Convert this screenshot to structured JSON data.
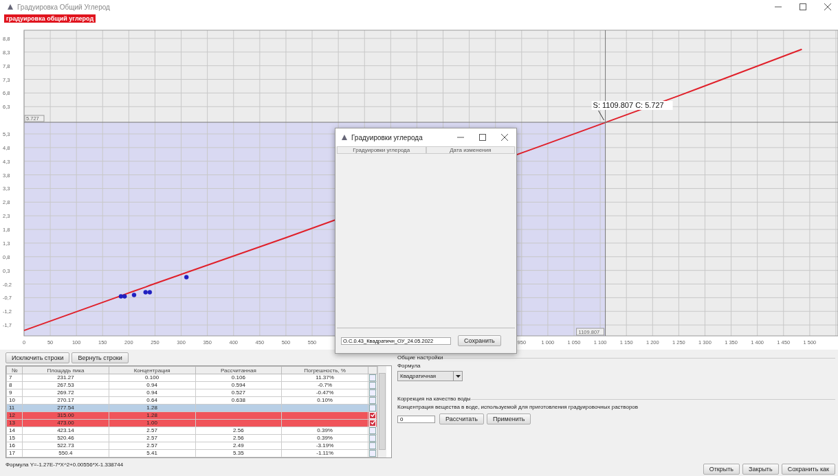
{
  "window": {
    "title": "Градуировка Общий Углерод"
  },
  "badge": "градуировка общий углерод",
  "chart": {
    "chart_data": {
      "type": "scatter",
      "grid": true,
      "x": [
        0,
        185,
        192,
        210,
        232,
        240,
        310,
        500,
        1000,
        1250,
        1485
      ],
      "series": [
        {
          "type": "line",
          "color": "#e0202a",
          "values": [
            -1.9,
            -0.63,
            -0.58,
            -0.46,
            -0.31,
            -0.25,
            0.22,
            1.5,
            4.95,
            6.7,
            8.4
          ]
        },
        {
          "color": "#2020c0",
          "values": [
            null,
            -0.65,
            -0.65,
            -0.6,
            -0.5,
            -0.5,
            0.05,
            null,
            null,
            null,
            null
          ]
        }
      ],
      "xlim": [
        0,
        1554
      ],
      "ylim": [
        -2.1,
        9.1
      ],
      "xticks": [
        0,
        50,
        100,
        150,
        200,
        250,
        300,
        350,
        400,
        450,
        500,
        550,
        950,
        {
          "value": 1000,
          "label": "1 000"
        },
        {
          "value": 1050,
          "label": "1 050"
        },
        {
          "value": 1100,
          "label": "1 100"
        },
        {
          "value": 1150,
          "label": "1 150"
        },
        {
          "value": 1200,
          "label": "1 200"
        },
        {
          "value": 1250,
          "label": "1 250"
        },
        {
          "value": 1300,
          "label": "1 300"
        },
        {
          "value": 1350,
          "label": "1 350"
        },
        {
          "value": 1400,
          "label": "1 400"
        },
        {
          "value": 1450,
          "label": "1 450"
        },
        {
          "value": 1500,
          "label": "1 500"
        }
      ],
      "yticks": [
        {
          "value": 8.8,
          "label": "8,8"
        },
        {
          "value": 8.3,
          "label": "8,3"
        },
        {
          "value": 7.8,
          "label": "7,8"
        },
        {
          "value": 7.3,
          "label": "7,3"
        },
        {
          "value": 6.8,
          "label": "6,8"
        },
        {
          "value": 6.3,
          "label": "6,3"
        },
        {
          "value": 5.3,
          "label": "5,3"
        },
        {
          "value": 4.8,
          "label": "4,8"
        },
        {
          "value": 4.3,
          "label": "4,3"
        },
        {
          "value": 3.8,
          "label": "3,8"
        },
        {
          "value": 3.3,
          "label": "3,3"
        },
        {
          "value": 2.8,
          "label": "2,8"
        },
        {
          "value": 2.3,
          "label": "2,3"
        },
        {
          "value": 1.8,
          "label": "1,8"
        },
        {
          "value": 1.3,
          "label": "1,3"
        },
        {
          "value": 0.8,
          "label": "0,8"
        },
        {
          "value": 0.3,
          "label": "0,3"
        },
        {
          "value": -0.2,
          "label": "-0,2"
        },
        {
          "value": -0.7,
          "label": "-0,7"
        },
        {
          "value": -1.2,
          "label": "-1,2"
        },
        {
          "value": -1.7,
          "label": "-1,7"
        }
      ],
      "ref_lines": [
        {
          "axis": "x",
          "value": 1109.807,
          "label": "1109.807"
        },
        {
          "axis": "y",
          "value": 5.727,
          "label": "5.727"
        }
      ],
      "annotations": [
        {
          "text": "S: 1109.807 C: 5.727",
          "x": 1109.807,
          "y": 5.727
        }
      ]
    }
  },
  "table_actions": [
    "Исключить строки",
    "Вернуть строки"
  ],
  "table": {
    "columns": [
      "№",
      "Площадь пика",
      "Концентрация",
      "Рассчитанная",
      "Погрешность, %"
    ],
    "rows": [
      {
        "cells": [
          "7",
          "231.27",
          "0.100",
          "0.106",
          "11.37%"
        ],
        "selected": false,
        "checked": false
      },
      {
        "cells": [
          "8",
          "267.53",
          "0.94",
          "0.594",
          "-0.7%"
        ],
        "selected": false,
        "checked": false
      },
      {
        "cells": [
          "9",
          "269.72",
          "0.94",
          "0.527",
          "-0.47%"
        ],
        "selected": false,
        "checked": false
      },
      {
        "cells": [
          "10",
          "270.17",
          "0.64",
          "0.638",
          "0.10%"
        ],
        "selected": false,
        "checked": false
      },
      {
        "cells": [
          "11",
          "277.54",
          "1.28"
        ],
        "selected": true,
        "checked": false
      },
      {
        "cells": [
          "12",
          "315.00",
          "1.28"
        ],
        "selected": false,
        "checked": true
      },
      {
        "cells": [
          "13",
          "473.00",
          "1.00"
        ],
        "selected": false,
        "checked": true
      },
      {
        "cells": [
          "14",
          "423.14",
          "2.57",
          "2.56",
          "0.39%"
        ],
        "selected": false,
        "checked": false
      },
      {
        "cells": [
          "15",
          "520.46",
          "2.57",
          "2.56",
          "0.39%"
        ],
        "selected": false,
        "checked": false
      },
      {
        "cells": [
          "16",
          "522.73",
          "2.57",
          "2.49",
          "-3.19%"
        ],
        "selected": false,
        "checked": false
      },
      {
        "cells": [
          "17",
          "550.4",
          "5.41",
          "5.35",
          "-1.11%"
        ],
        "selected": false,
        "checked": false
      }
    ]
  },
  "formula": "Формула Y=-1.27E-7*X^2+0.00556*X-1.338744",
  "settings": {
    "title": "Общие настройки",
    "formula_label": "Формула",
    "formula_value": "Квадратичная"
  },
  "water": {
    "title": "Коррекция на качество воды",
    "description": "Концентрация вещества в воде, используемой для приготовления градуировочных растворов",
    "value": "0",
    "buttons": [
      "Рассчитать",
      "Применить"
    ]
  },
  "footer_buttons": [
    "Открыть",
    "Закрыть",
    "Сохранить как"
  ],
  "dialog": {
    "title": "Градуировки углерода",
    "columns": [
      "Градуировки углерода",
      "Дата изменения"
    ],
    "file_name": "О.С.0.43_Квадратичн_ОУ_24.05.2022",
    "save": "Сохранить"
  }
}
